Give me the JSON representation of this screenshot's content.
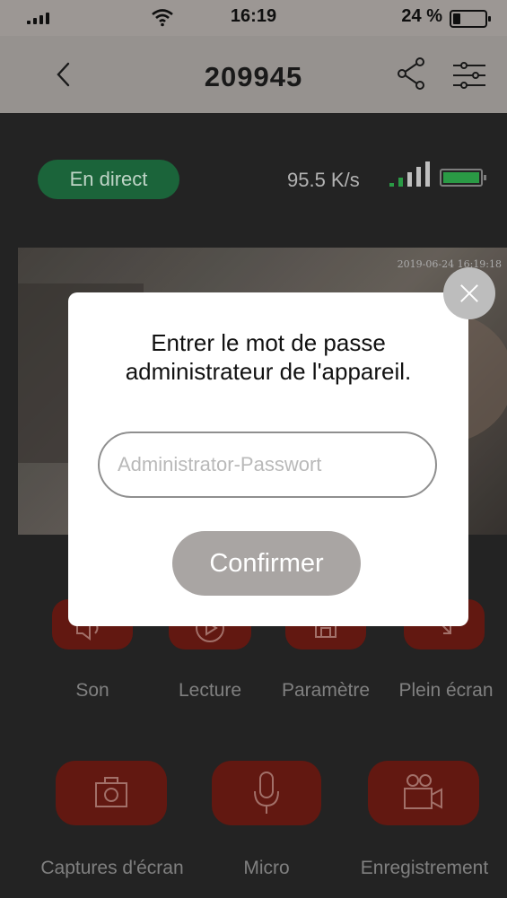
{
  "status_bar": {
    "time": "16:19",
    "battery_text": "24 %",
    "battery_level": 0.24
  },
  "nav": {
    "title": "209945"
  },
  "stream": {
    "live_badge": "En direct",
    "speed": "95.5 K/s",
    "timestamp": "2019-06-24 16:19:18",
    "live_color": "#1e6d3f",
    "battery_color": "#2ea84b"
  },
  "controls_row1": [
    {
      "label": "Son",
      "icon": "speaker-icon"
    },
    {
      "label": "Lecture",
      "icon": "play-icon"
    },
    {
      "label": "Paramètre",
      "icon": "save-icon"
    },
    {
      "label": "Plein écran",
      "icon": "fullscreen-icon"
    }
  ],
  "controls_row2": [
    {
      "label": "Captures d'écran",
      "icon": "camera-icon"
    },
    {
      "label": "Micro",
      "icon": "microphone-icon"
    },
    {
      "label": "Enregistrement",
      "icon": "video-record-icon"
    }
  ],
  "dialog": {
    "message_line1": "Entrer le mot de passe",
    "message_line2": "administrateur de l'appareil.",
    "input_placeholder": "Administrator-Passwort",
    "input_value": "",
    "confirm_label": "Confirmer"
  },
  "colors": {
    "control_button": "#6b1b13",
    "confirm_button": "#a9a5a3",
    "navbar": "#a39f9c"
  }
}
